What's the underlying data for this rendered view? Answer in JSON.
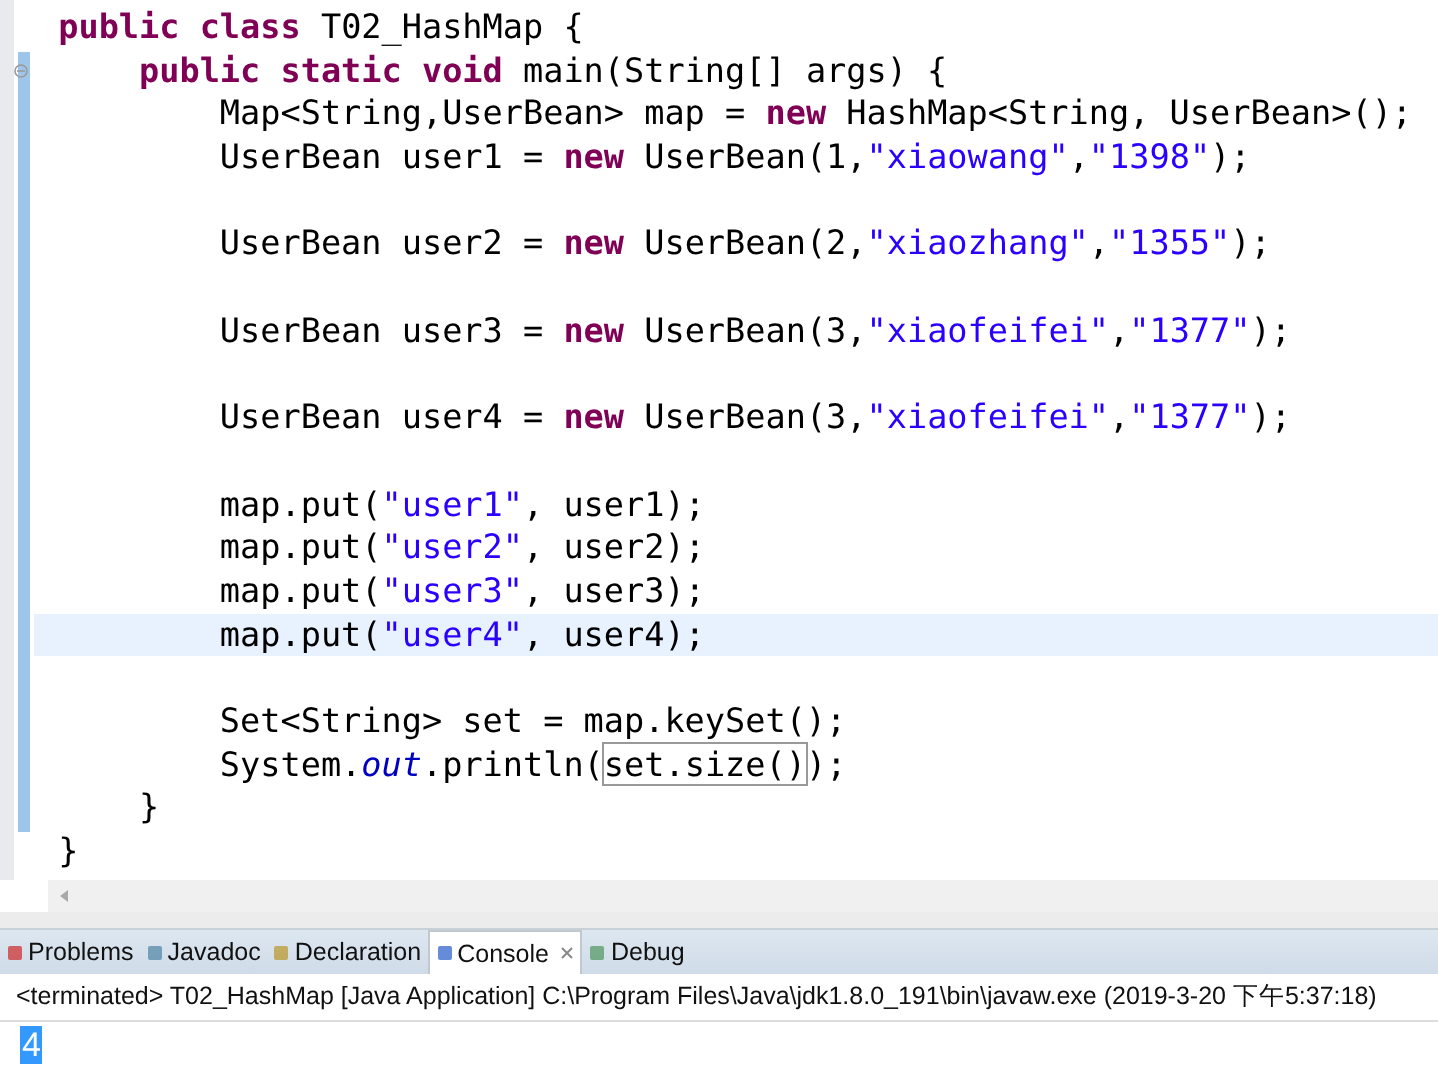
{
  "editor": {
    "lines": [
      {
        "current": false,
        "tokens": [
          {
            "kind": "kw",
            "text": "public class"
          },
          {
            "kind": "plain",
            "text": " T02_HashMap {"
          }
        ]
      },
      {
        "current": false,
        "fold": true,
        "tokens": [
          {
            "kind": "kw",
            "text": "    public static void"
          },
          {
            "kind": "plain",
            "text": " main(String[] args) {"
          }
        ]
      },
      {
        "current": false,
        "tokens": [
          {
            "kind": "plain",
            "text": "        Map<String,UserBean> map = "
          },
          {
            "kind": "kw",
            "text": "new"
          },
          {
            "kind": "plain",
            "text": " HashMap<String, UserBean>();"
          }
        ]
      },
      {
        "current": false,
        "tokens": [
          {
            "kind": "plain",
            "text": "        UserBean user1 = "
          },
          {
            "kind": "kw",
            "text": "new"
          },
          {
            "kind": "plain",
            "text": " UserBean(1,"
          },
          {
            "kind": "str",
            "text": "\"xiaowang\""
          },
          {
            "kind": "plain",
            "text": ","
          },
          {
            "kind": "str",
            "text": "\"1398\""
          },
          {
            "kind": "plain",
            "text": ");"
          }
        ]
      },
      {
        "current": false
      },
      {
        "current": false,
        "tokens": [
          {
            "kind": "plain",
            "text": "        UserBean user2 = "
          },
          {
            "kind": "kw",
            "text": "new"
          },
          {
            "kind": "plain",
            "text": " UserBean(2,"
          },
          {
            "kind": "str",
            "text": "\"xiaozhang\""
          },
          {
            "kind": "plain",
            "text": ","
          },
          {
            "kind": "str",
            "text": "\"1355\""
          },
          {
            "kind": "plain",
            "text": ");"
          }
        ]
      },
      {
        "current": false
      },
      {
        "current": false,
        "tokens": [
          {
            "kind": "plain",
            "text": "        UserBean user3 = "
          },
          {
            "kind": "kw",
            "text": "new"
          },
          {
            "kind": "plain",
            "text": " UserBean(3,"
          },
          {
            "kind": "str",
            "text": "\"xiaofeifei\""
          },
          {
            "kind": "plain",
            "text": ","
          },
          {
            "kind": "str",
            "text": "\"1377\""
          },
          {
            "kind": "plain",
            "text": ");"
          }
        ]
      },
      {
        "current": false
      },
      {
        "current": false,
        "tokens": [
          {
            "kind": "plain",
            "text": "        UserBean user4 = "
          },
          {
            "kind": "kw",
            "text": "new"
          },
          {
            "kind": "plain",
            "text": " UserBean(3,"
          },
          {
            "kind": "str",
            "text": "\"xiaofeifei\""
          },
          {
            "kind": "plain",
            "text": ","
          },
          {
            "kind": "str",
            "text": "\"1377\""
          },
          {
            "kind": "plain",
            "text": ");"
          }
        ]
      },
      {
        "current": false
      },
      {
        "current": false,
        "tokens": [
          {
            "kind": "plain",
            "text": "        map.put("
          },
          {
            "kind": "str",
            "text": "\"user1\""
          },
          {
            "kind": "plain",
            "text": ", user1);"
          }
        ]
      },
      {
        "current": false,
        "tokens": [
          {
            "kind": "plain",
            "text": "        map.put("
          },
          {
            "kind": "str",
            "text": "\"user2\""
          },
          {
            "kind": "plain",
            "text": ", user2);"
          }
        ]
      },
      {
        "current": false,
        "tokens": [
          {
            "kind": "plain",
            "text": "        map.put("
          },
          {
            "kind": "str",
            "text": "\"user3\""
          },
          {
            "kind": "plain",
            "text": ", user3);"
          }
        ]
      },
      {
        "current": true,
        "tokens": [
          {
            "kind": "plain",
            "text": "        map.put("
          },
          {
            "kind": "str",
            "text": "\"user4\""
          },
          {
            "kind": "plain",
            "text": ", user4);"
          }
        ]
      },
      {
        "current": false
      },
      {
        "current": false,
        "tokens": [
          {
            "kind": "plain",
            "text": "        Set<String> set = map.keySet();"
          }
        ]
      },
      {
        "current": false,
        "tokens": [
          {
            "kind": "plain",
            "text": "        System."
          },
          {
            "kind": "field",
            "text": "out"
          },
          {
            "kind": "plain",
            "text": ".println("
          },
          {
            "kind": "match",
            "text": "set.size()"
          },
          {
            "kind": "plain",
            "text": ");"
          }
        ]
      },
      {
        "current": false,
        "tokens": [
          {
            "kind": "plain",
            "text": "    }"
          }
        ]
      },
      {
        "current": false,
        "tokens": [
          {
            "kind": "plain",
            "text": "}"
          }
        ]
      }
    ]
  },
  "panel": {
    "tabs": [
      {
        "label": "Problems",
        "selected": false
      },
      {
        "label": "Javadoc",
        "selected": false
      },
      {
        "label": "Declaration",
        "selected": false
      },
      {
        "label": "Console",
        "selected": true
      },
      {
        "label": "Debug",
        "selected": false
      }
    ],
    "status": "<terminated> T02_HashMap [Java Application] C:\\Program Files\\Java\\jdk1.8.0_191\\bin\\javaw.exe (2019-3-20 下午5:37:18)",
    "output": "4"
  }
}
